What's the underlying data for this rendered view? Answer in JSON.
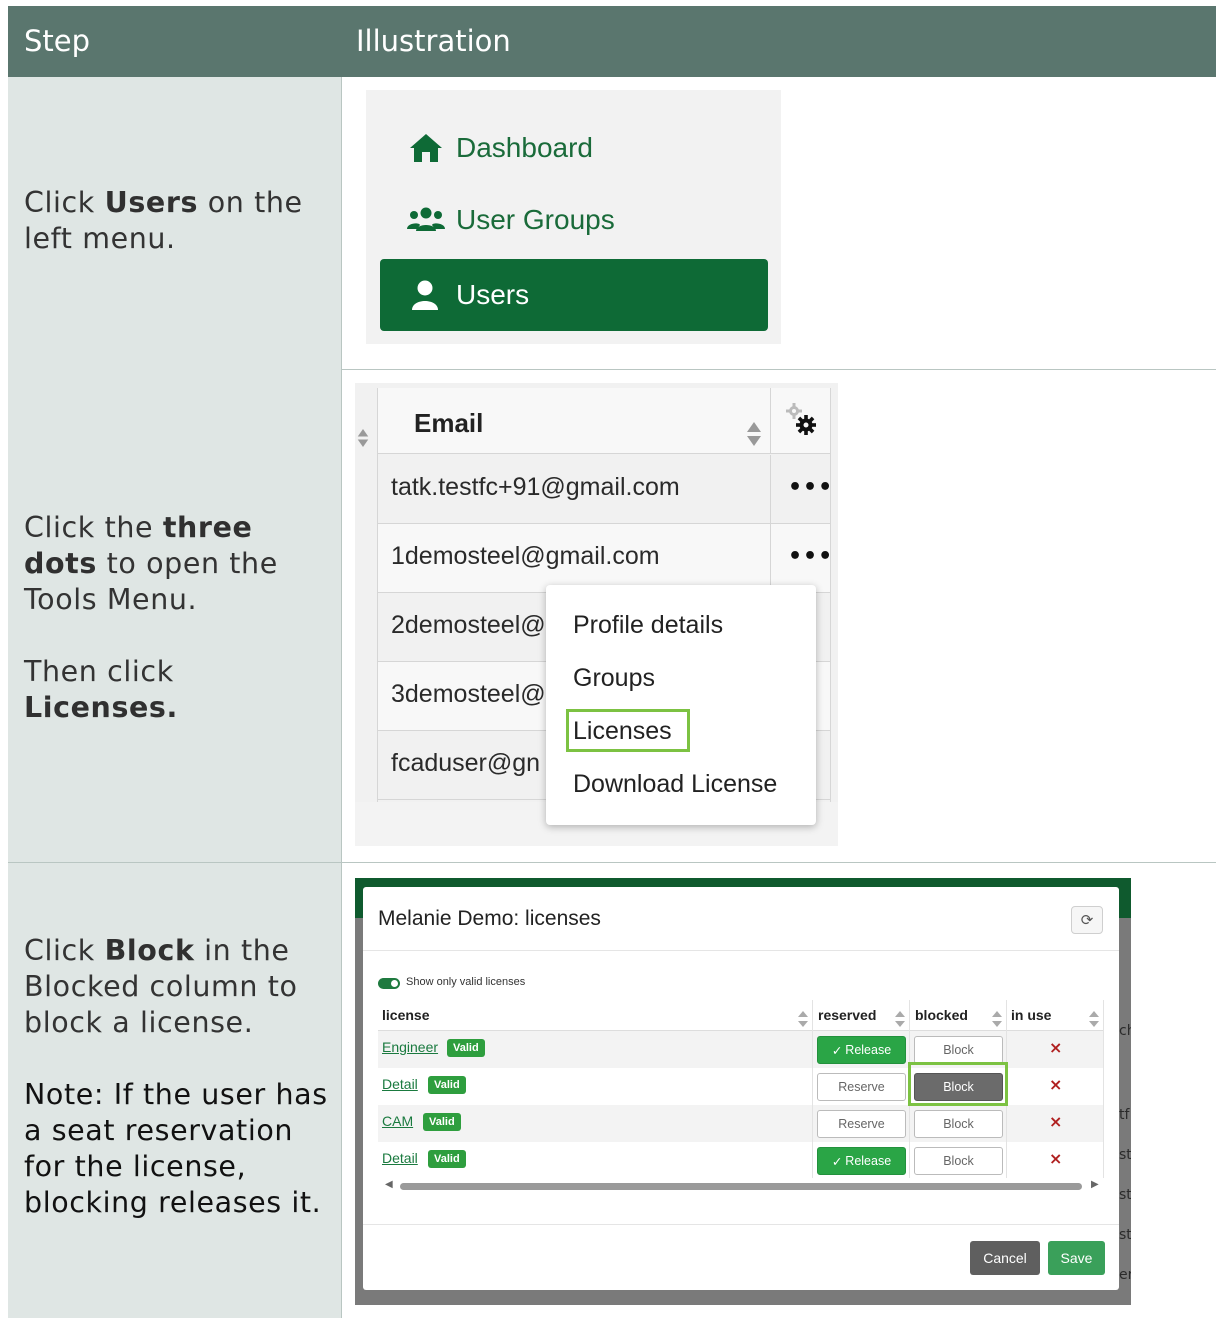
{
  "header": {
    "step": "Step",
    "illustration": "Illustration"
  },
  "steps": [
    {
      "parts": [
        [
          "Click ",
          false
        ],
        [
          "Users",
          true
        ],
        [
          " on the left menu.",
          false
        ]
      ]
    },
    {
      "parts": [
        [
          "Click the ",
          false
        ],
        [
          "three dots",
          true
        ],
        [
          " to open the Tools Menu.",
          false
        ]
      ],
      "then": [
        [
          "Then click ",
          false
        ],
        [
          "Licenses.",
          true
        ]
      ]
    },
    {
      "parts": [
        [
          "Click ",
          false
        ],
        [
          "Block",
          true
        ],
        [
          " in the Blocked column to block a license.",
          false
        ]
      ],
      "note": "Note: If the user has a seat reservation for the license, blocking releases it."
    }
  ],
  "menu": {
    "items": [
      {
        "label": "Dashboard",
        "icon": "house-icon"
      },
      {
        "label": "User Groups",
        "icon": "users-group-icon"
      },
      {
        "label": "Users",
        "icon": "user-icon",
        "active": true
      }
    ],
    "active_color": "#0e6a36"
  },
  "email_table": {
    "column_header": "Email",
    "rows": [
      "tatk.testfc+91@gmail.com",
      "1demosteel@gmail.com",
      "2demosteel@",
      "3demosteel@",
      "fcaduser@gn"
    ],
    "row_menu_glyph": "•••",
    "context_menu": [
      "Profile details",
      "Groups",
      "Licenses",
      "Download License"
    ],
    "highlighted_item": "Licenses"
  },
  "licenses_dialog": {
    "title": "Melanie Demo: licenses",
    "toggle_label": "Show only valid licenses",
    "columns": [
      "license",
      "reserved",
      "blocked",
      "in use"
    ],
    "rows": [
      {
        "name": "Engineer",
        "badge": "Valid",
        "reserved": "Release",
        "reserved_active": true,
        "blocked": "Block",
        "blocked_active": false,
        "in_use": "×"
      },
      {
        "name": "Detail",
        "badge": "Valid",
        "reserved": "Reserve",
        "reserved_active": false,
        "blocked": "Block",
        "blocked_active": true,
        "in_use": "×"
      },
      {
        "name": "CAM",
        "badge": "Valid",
        "reserved": "Reserve",
        "reserved_active": false,
        "blocked": "Block",
        "blocked_active": false,
        "in_use": "×"
      },
      {
        "name": "Detail",
        "badge": "Valid",
        "reserved": "Release",
        "reserved_active": true,
        "blocked": "Block",
        "blocked_active": false,
        "in_use": "×"
      }
    ],
    "check_glyph": "✓",
    "cancel": "Cancel",
    "save": "Save",
    "background_fragments": [
      "ch",
      "tf",
      "st",
      "st",
      "st",
      "er"
    ]
  },
  "colors": {
    "header": "#5a766e",
    "step_bg": "#dfe6e4",
    "highlight": "#7cc242",
    "brand_green": "#0e6a36"
  }
}
